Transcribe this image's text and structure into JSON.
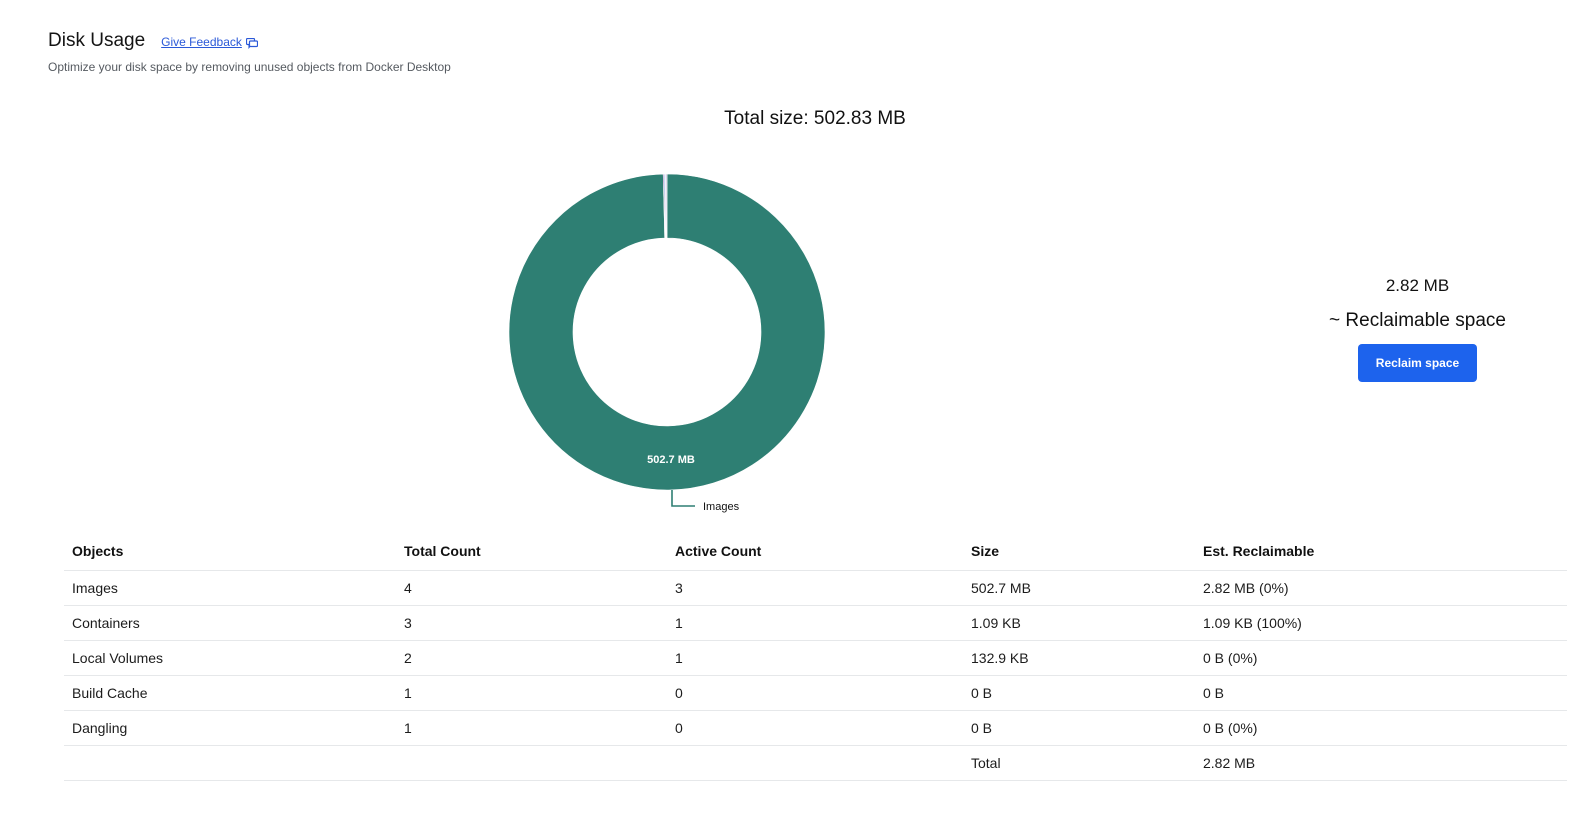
{
  "header": {
    "title": "Disk Usage",
    "feedback_label": "Give Feedback",
    "feedback_icon": "feedback-icon",
    "subtitle": "Optimize your disk space by removing unused objects from Docker Desktop"
  },
  "summary": {
    "total_size": "Total size: 502.83 MB"
  },
  "chart_data": {
    "type": "pie",
    "donut": true,
    "slices": [
      {
        "name": "Images",
        "value": 502.7,
        "unit": "MB",
        "color": "#2e7f73",
        "label": "502.7 MB",
        "callout": "Images"
      },
      {
        "name": "Containers",
        "value": 0.00109,
        "unit": "MB",
        "color": "#6b2e8f"
      },
      {
        "name": "Local Volumes",
        "value": 0.1329,
        "unit": "MB",
        "color": "#3b6fd6"
      },
      {
        "name": "Build Cache",
        "value": 0,
        "unit": "MB",
        "color": "#c8b6e0"
      },
      {
        "name": "Dangling",
        "value": 0,
        "unit": "MB",
        "color": "#8e7cc3"
      }
    ]
  },
  "reclaim": {
    "amount": "2.82 MB",
    "label": "~ Reclaimable space",
    "button_label": "Reclaim space",
    "button_color": "#1d63ed"
  },
  "table": {
    "headers": [
      "Objects",
      "Total Count",
      "Active Count",
      "Size",
      "Est. Reclaimable"
    ],
    "rows": [
      [
        "Images",
        "4",
        "3",
        "502.7 MB",
        "2.82 MB (0%)"
      ],
      [
        "Containers",
        "3",
        "1",
        "1.09 KB",
        "1.09 KB (100%)"
      ],
      [
        "Local Volumes",
        "2",
        "1",
        "132.9 KB",
        "0 B (0%)"
      ],
      [
        "Build Cache",
        "1",
        "0",
        "0 B",
        "0 B"
      ],
      [
        "Dangling",
        "1",
        "0",
        "0 B",
        "0 B (0%)"
      ]
    ],
    "total_label": "Total",
    "total_value": "2.82 MB"
  }
}
